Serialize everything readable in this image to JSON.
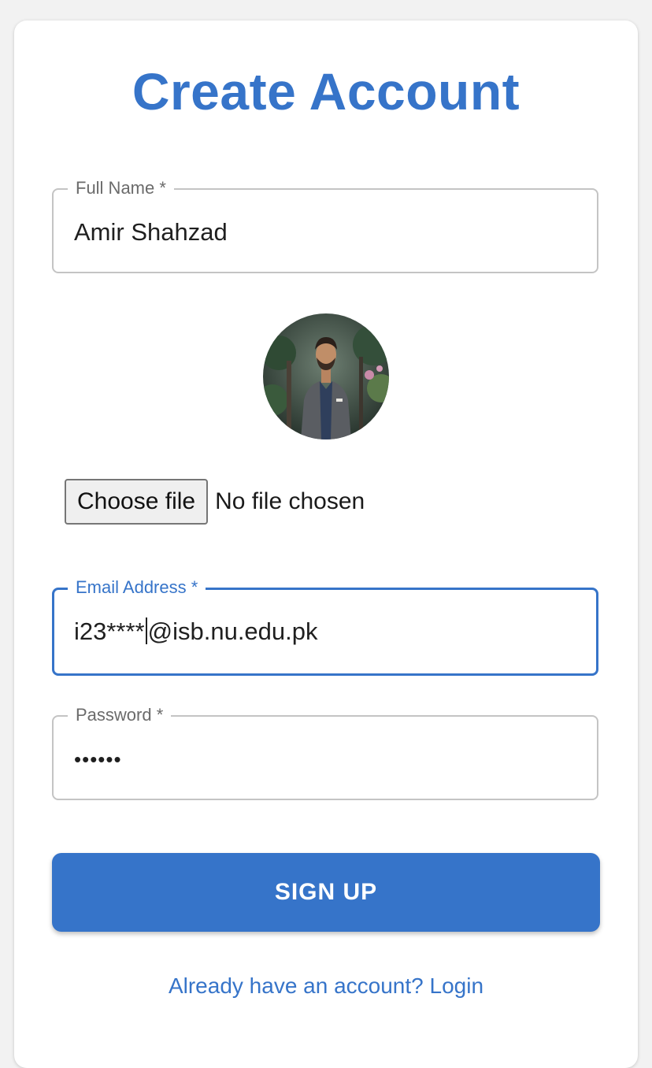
{
  "form": {
    "title": "Create Account",
    "full_name": {
      "label": "Full Name *",
      "value": "Amir Shahzad"
    },
    "avatar": {
      "alt": "profile-photo"
    },
    "file_input": {
      "button_label": "Choose file",
      "status": "No file chosen"
    },
    "email": {
      "label": "Email Address *",
      "value_before_caret": "i23****",
      "value_after_caret": "@isb.nu.edu.pk"
    },
    "password": {
      "label": "Password *",
      "value": "••••••"
    },
    "submit_label": "SIGN UP",
    "login_link": "Already have an account? Login"
  },
  "colors": {
    "accent": "#3674c9",
    "border": "#c4c4c4",
    "label": "#6b6b6b"
  }
}
